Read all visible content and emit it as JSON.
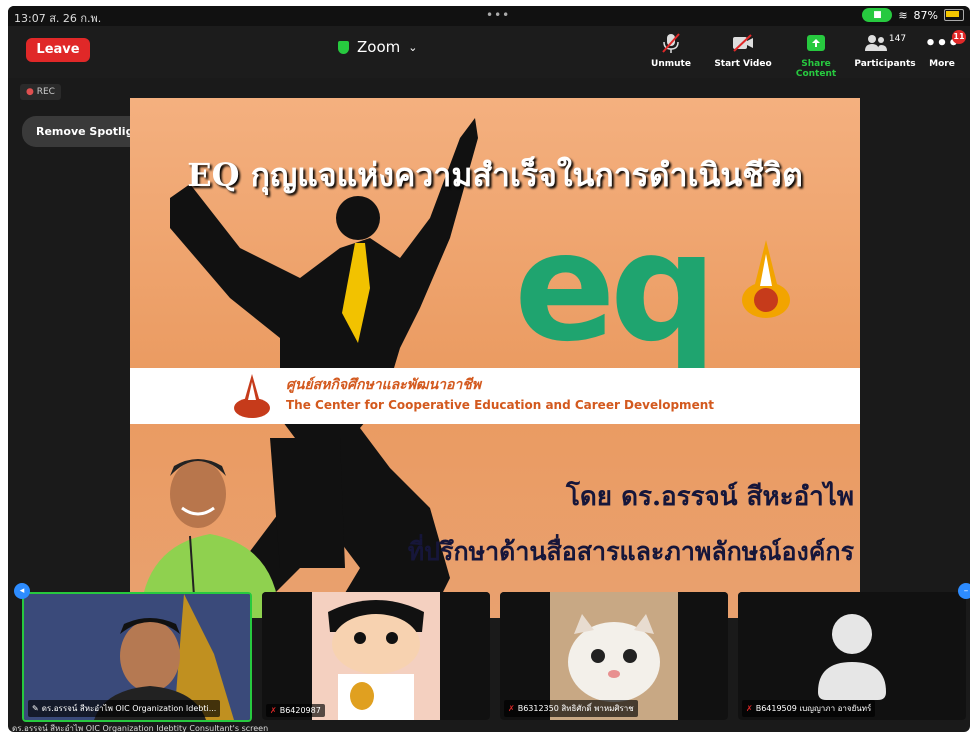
{
  "status_bar": {
    "time": "13:07  ส. 26 ก.พ.",
    "more_dots": "•••",
    "battery": "87%"
  },
  "toolbar": {
    "leave_label": "Leave",
    "app_title": "Zoom",
    "unmute_label": "Unmute",
    "start_video_label": "Start Video",
    "share_content_label": "Share Content",
    "participants_label": "Participants",
    "participants_count": "147",
    "more_label": "More",
    "more_badge": "11"
  },
  "rec_label": "REC",
  "remove_spotlight_label": "Remove Spotlight",
  "slide": {
    "title": "EQ กุญแจแห่งความสำเร็จในการดำเนินชีวิต",
    "logo_text": "eq",
    "band_thai": "ศูนย์สหกิจศึกษาและพัฒนาอาชีพ",
    "band_english": "The Center for Cooperative Education and Career Development",
    "presenter_line": "โดย ดร.อรรจน์ สีหะอำไพ",
    "role_line": "ที่ปรึกษาด้านสื่อสารและภาพลักษณ์องค์กร"
  },
  "colors": {
    "accent_green": "#27c93f",
    "leave_red": "#e02828",
    "eq_green": "#1fa46f",
    "slide_orange": "#ea9a60"
  },
  "participants": [
    {
      "name": "ดร.อรรจน์ สีหะอำไพ OIC Organization Idebti..."
    },
    {
      "name": "B6420987"
    },
    {
      "name": "B6312350 สิทธิศักดิ์ พาหมศิราช"
    },
    {
      "name": "B6419509 เบญญาภา อาจยันทร์"
    }
  ],
  "screen_share_label": "ดร.อรรจน์ สีหะอำไพ OIC Organization Idebtity Consultant's screen"
}
